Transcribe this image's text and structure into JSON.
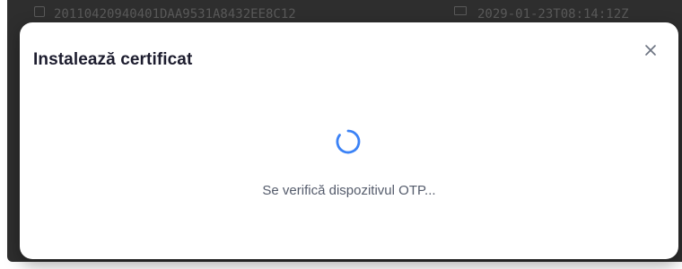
{
  "background": {
    "row": {
      "id": "20110420940401DAA9531A8432EE8C12",
      "timestamp": "2029-01-23T08:14:12Z"
    }
  },
  "modal": {
    "title": "Instalează certificat",
    "status": "Se verifică dispozitivul OTP...",
    "close_icon": "close-icon",
    "spinner_icon": "loading-spinner-icon",
    "accent_color": "#3b82f6"
  }
}
